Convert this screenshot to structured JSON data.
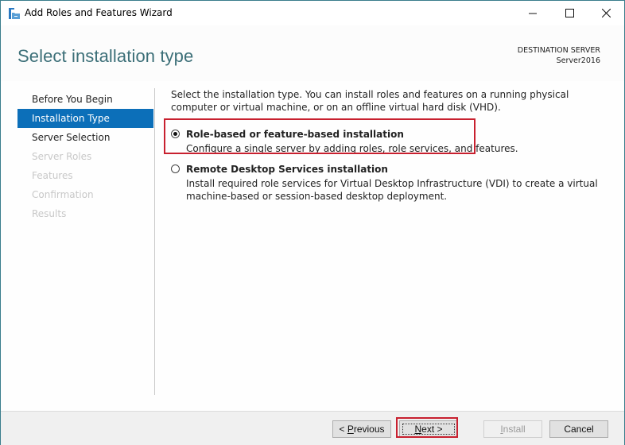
{
  "window": {
    "title": "Add Roles and Features Wizard",
    "controls": {
      "minimize": "minimize",
      "maximize": "maximize",
      "close": "close"
    }
  },
  "header": {
    "page_title": "Select installation type",
    "destination_label": "DESTINATION SERVER",
    "destination_server": "Server2016"
  },
  "sidebar": {
    "items": [
      {
        "label": "Before You Begin",
        "state": "enabled"
      },
      {
        "label": "Installation Type",
        "state": "selected"
      },
      {
        "label": "Server Selection",
        "state": "enabled"
      },
      {
        "label": "Server Roles",
        "state": "disabled"
      },
      {
        "label": "Features",
        "state": "disabled"
      },
      {
        "label": "Confirmation",
        "state": "disabled"
      },
      {
        "label": "Results",
        "state": "disabled"
      }
    ]
  },
  "content": {
    "intro": "Select the installation type. You can install roles and features on a running physical computer or virtual machine, or on an offline virtual hard disk (VHD).",
    "options": [
      {
        "title": "Role-based or feature-based installation",
        "description": "Configure a single server by adding roles, role services, and features.",
        "checked": true,
        "highlighted": true
      },
      {
        "title": "Remote Desktop Services installation",
        "description": "Install required role services for Virtual Desktop Infrastructure (VDI) to create a virtual machine-based or session-based desktop deployment.",
        "checked": false,
        "highlighted": false
      }
    ]
  },
  "footer": {
    "previous": {
      "prefix": "< ",
      "accel": "P",
      "rest": "revious"
    },
    "next": {
      "accel": "N",
      "rest": "ext >",
      "highlighted": true
    },
    "install": {
      "accel": "I",
      "rest": "nstall",
      "enabled": false
    },
    "cancel": {
      "label": "Cancel"
    }
  },
  "colors": {
    "accent": "#0c6fb9",
    "highlight_border": "#c8202f",
    "title_text": "#3c6f78",
    "window_border": "#3a7d8c"
  }
}
